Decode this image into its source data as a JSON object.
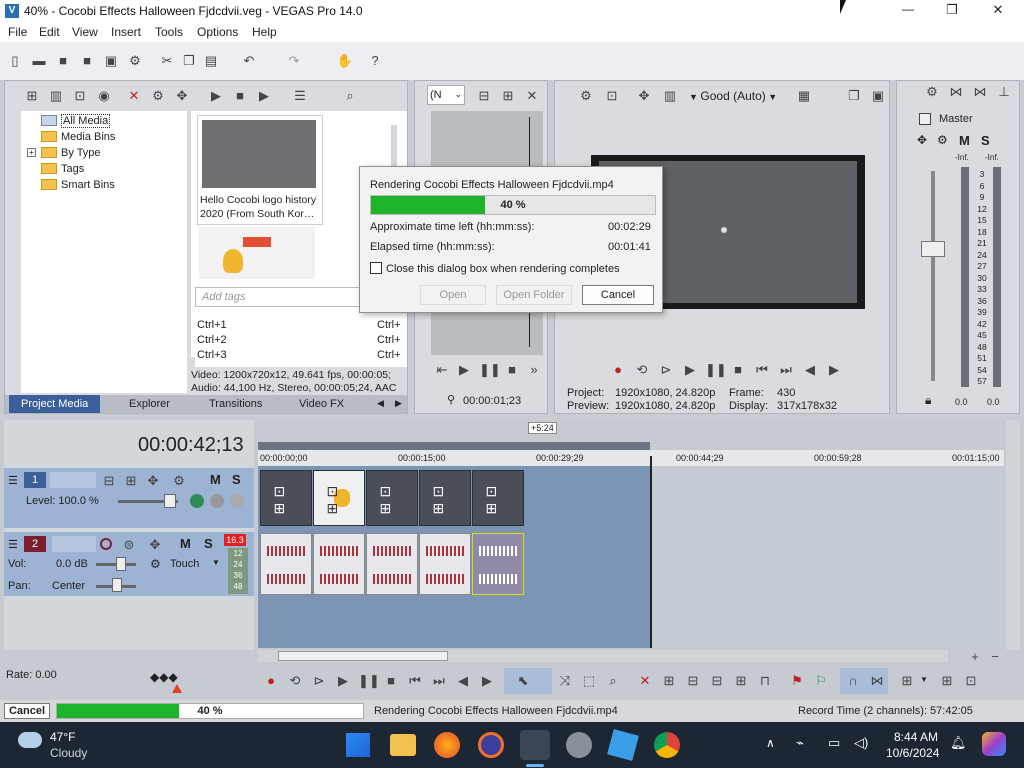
{
  "window": {
    "title": "40% - Cocobi Effects Halloween Fjdcdvii.veg - VEGAS Pro 14.0",
    "minimize_glyph": "—",
    "restore_glyph": "❐",
    "close_glyph": "✕"
  },
  "menu": [
    "File",
    "Edit",
    "View",
    "Insert",
    "Tools",
    "Options",
    "Help"
  ],
  "media": {
    "tree": [
      "All Media",
      "Media Bins",
      "By Type",
      "Tags",
      "Smart Bins"
    ],
    "thumb1_caption_line1": "Hello Cocobi logo history",
    "thumb1_caption_line2": "2020 (From South Kor…",
    "tag_placeholder": "Add tags",
    "shortcuts": [
      "Ctrl+1",
      "Ctrl+2",
      "Ctrl+3"
    ],
    "shortcuts_right": [
      "Ctrl+",
      "Ctrl+",
      "Ctrl+"
    ],
    "video_info": "Video: 1200x720x12, 49.641 fps, 00:00:05;",
    "audio_info": "Audio: 44,100 Hz, Stereo, 00:00:05;24, AAC",
    "tabs": [
      "Project Media",
      "Explorer",
      "Transitions",
      "Video FX"
    ]
  },
  "trimmer": {
    "dropdown": "(N",
    "timecode": "00:00:01;23"
  },
  "preview": {
    "quality": "Good (Auto)",
    "project_label": "Project:",
    "project_value": "1920x1080, 24.820p",
    "preview_label": "Preview:",
    "preview_value": "1920x1080, 24.820p",
    "frame_label": "Frame:",
    "frame_value": "430",
    "display_label": "Display:",
    "display_value": "317x178x32"
  },
  "master": {
    "label": "Master",
    "ticks": [
      "-Inf.",
      "-Inf.",
      "3",
      "6",
      "9",
      "12",
      "15",
      "18",
      "21",
      "24",
      "27",
      "30",
      "33",
      "36",
      "39",
      "42",
      "45",
      "48",
      "51",
      "54",
      "57"
    ],
    "bottom_left": "0.0",
    "bottom_right": "0.0"
  },
  "dialog": {
    "title": "Rendering Cocobi Effects Halloween Fjdcdvii.mp4",
    "progress": 0.4,
    "progress_text": "40 %",
    "time_left_label": "Approximate time left (hh:mm:ss):",
    "time_left_value": "00:02:29",
    "elapsed_label": "Elapsed time (hh:mm:ss):",
    "elapsed_value": "00:01:41",
    "checkbox_label": "Close this dialog box when rendering completes",
    "open_button": "Open",
    "open_folder_button": "Open Folder",
    "cancel_button": "Cancel"
  },
  "timeline": {
    "main_timecode": "00:00:42;13",
    "loop_length": "+5:24",
    "ruler_marks": [
      "00:00:00;00",
      "00:00:15;00",
      "00:00:29;29",
      "00:00:44;29",
      "00:00:59;28",
      "00:01:15;00"
    ],
    "track1_number": "1",
    "track1_level": "Level: 100.0 %",
    "track2_number": "2",
    "track2_vol_label": "Vol:",
    "track2_vol_value": "0.0 dB",
    "track2_pan_label": "Pan:",
    "track2_pan_value": "Center",
    "touch_label": "Touch",
    "meter_top": "16.3",
    "meter_ticks": [
      "12",
      "24",
      "36",
      "48"
    ],
    "rate_label": "Rate: 0.00"
  },
  "status": {
    "cancel_button": "Cancel",
    "progress": 0.4,
    "progress_text": "40 %",
    "message": "Rendering Cocobi Effects Halloween Fjdcdvii.mp4",
    "record_time": "Record Time (2 channels): 57:42:05"
  },
  "taskbar": {
    "temperature": "47°F",
    "weather": "Cloudy",
    "time": "8:44 AM",
    "date": "10/6/2024"
  },
  "colors": {
    "accent": "#3b5f9a",
    "progress_green": "#1db32b",
    "timeline_blue": "#7d95b5",
    "track_blue": "#9db3d3"
  }
}
